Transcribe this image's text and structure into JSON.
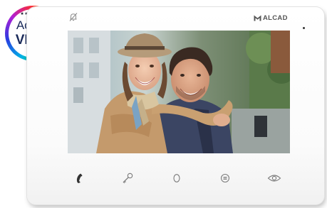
{
  "badge": {
    "line1": "Active",
    "line2": "VIEW",
    "stars": "★★★★★★"
  },
  "brand": {
    "name": "ALCAD",
    "mark": "M"
  },
  "screen": {
    "image": "couple-portrait-photo"
  },
  "icons": {
    "top": "bell-off-icon",
    "buttons": [
      "phone-handset-icon",
      "key-icon",
      "circle-icon",
      "menu-icon",
      "eye-icon"
    ]
  },
  "colors": {
    "device_body": "#ffffff",
    "icon_gray": "#7a7a7a",
    "phone_icon": "#333333",
    "badge_text": "#1a2a5a"
  }
}
